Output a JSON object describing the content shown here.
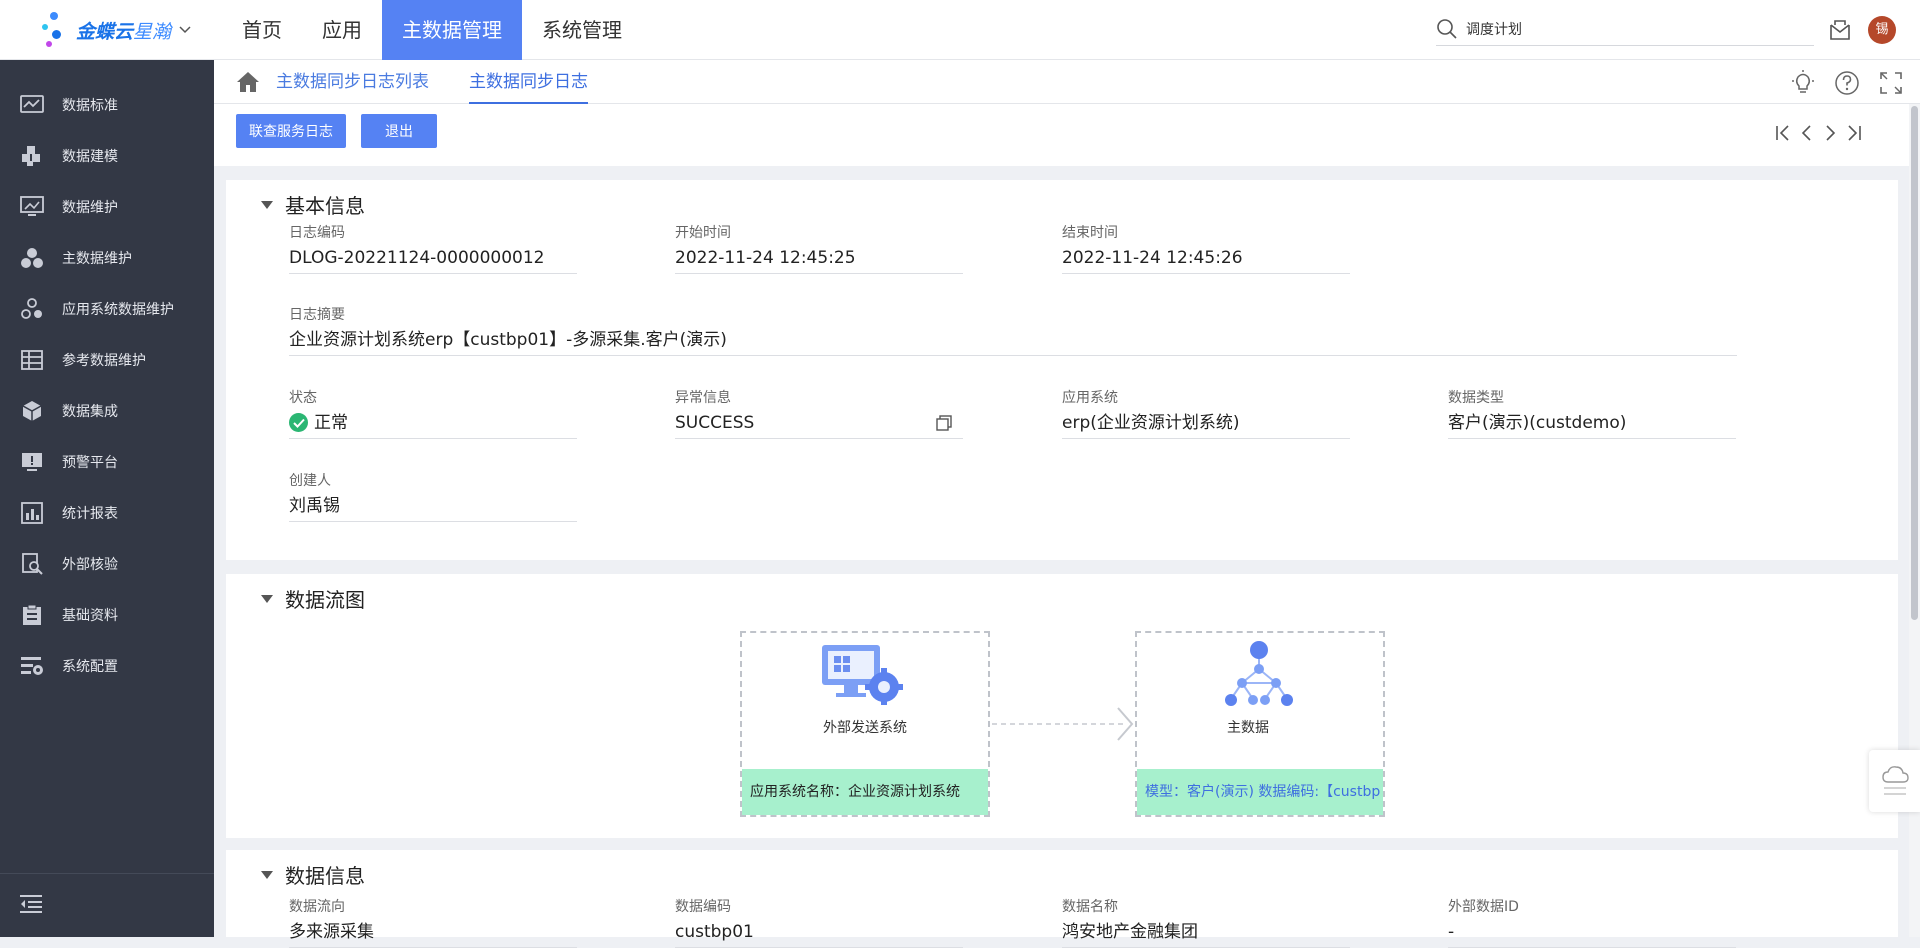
{
  "app": {
    "brand": "金蝶云",
    "brand_sub": "星瀚",
    "colors": {
      "accent": "#5582f3",
      "sidebar_bg": "#333845",
      "status_ok": "#2bb673",
      "flow_info_bg": "#a7f0cd"
    }
  },
  "topnav": {
    "items": [
      "首页",
      "应用",
      "主数据管理",
      "系统管理"
    ],
    "active": "主数据管理"
  },
  "search": {
    "value": "调度计划",
    "icon": "search-icon"
  },
  "user": {
    "avatar_text": "锡"
  },
  "sidebar": {
    "items": [
      {
        "label": "数据标准",
        "icon": "chart-board-icon"
      },
      {
        "label": "数据建模",
        "icon": "puzzle-icon"
      },
      {
        "label": "数据维护",
        "icon": "monitor-icon"
      },
      {
        "label": "主数据维护",
        "icon": "cluster-icon"
      },
      {
        "label": "应用系统数据维护",
        "icon": "cluster-gear-icon"
      },
      {
        "label": "参考数据维护",
        "icon": "table-grid-icon"
      },
      {
        "label": "数据集成",
        "icon": "cube-icon"
      },
      {
        "label": "预警平台",
        "icon": "alert-screen-icon"
      },
      {
        "label": "统计报表",
        "icon": "report-icon"
      },
      {
        "label": "外部核验",
        "icon": "search-doc-icon"
      },
      {
        "label": "基础资料",
        "icon": "clipboard-icon"
      },
      {
        "label": "系统配置",
        "icon": "settings-list-icon"
      }
    ],
    "collapse_icon": "collapse-menu-icon"
  },
  "tabs": {
    "items": [
      "主数据同步日志列表",
      "主数据同步日志"
    ],
    "active": "主数据同步日志"
  },
  "toolbar": {
    "query_log_label": "联查服务日志",
    "exit_label": "退出"
  },
  "basic": {
    "title": "基本信息",
    "log_code_label": "日志编码",
    "log_code": "DLOG-20221124-0000000012",
    "start_label": "开始时间",
    "start": "2022-11-24 12:45:25",
    "end_label": "结束时间",
    "end": "2022-11-24 12:45:26",
    "summary_label": "日志摘要",
    "summary": "企业资源计划系统erp【custbp01】-多源采集.客户(演示)",
    "status_label": "状态",
    "status": "正常",
    "error_label": "异常信息",
    "error": "SUCCESS",
    "app_system_label": "应用系统",
    "app_system": "erp(企业资源计划系统)",
    "data_type_label": "数据类型",
    "data_type": "客户(演示)(custdemo)",
    "creator_label": "创建人",
    "creator": "刘禹锡"
  },
  "flow": {
    "title": "数据流图",
    "source_label": "外部发送系统",
    "source_info": "应用系统名称：企业资源计划系统",
    "target_label": "主数据",
    "target_info": "模型：客户(演示) 数据编码:【custbp"
  },
  "datainfo": {
    "title": "数据信息",
    "direction_label": "数据流向",
    "direction": "多来源采集",
    "code_label": "数据编码",
    "code": "custbp01",
    "name_label": "数据名称",
    "name": "鸿安地产金融集团",
    "ext_id_label": "外部数据ID",
    "ext_id": "-"
  }
}
